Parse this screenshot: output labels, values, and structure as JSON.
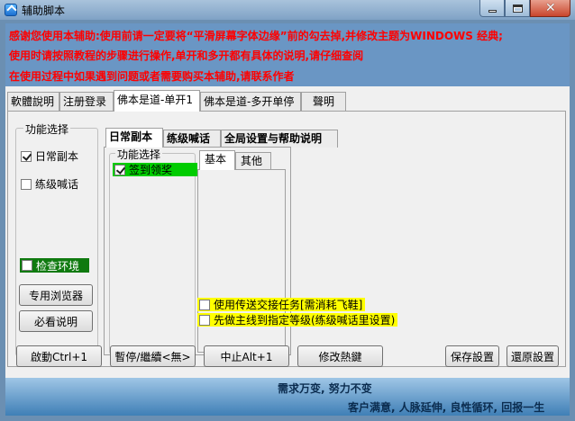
{
  "window": {
    "title": "辅助脚本"
  },
  "notice": {
    "line1": "感谢您使用本辅助:使用前请一定要将“平滑屏幕字体边缘”前的勾去掉,并修改主题为WINDOWS 经典;",
    "line2": "使用时请按照教程的步骤进行操作,单开和多开都有具体的说明,请仔细查阅",
    "line3": "在使用过程中如果遇到问题或者需要购买本辅助,请联系作者"
  },
  "top_tabs": [
    {
      "label": "軟體說明"
    },
    {
      "label": "注册登录"
    },
    {
      "label": "佛本是道-单开1"
    },
    {
      "label": "佛本是道-多开单停"
    },
    {
      "label": "聲明"
    }
  ],
  "left_group": {
    "caption": "功能选择",
    "daily_label": "日常副本",
    "daily_checked": true,
    "level_label": "练级喊话",
    "level_checked": false,
    "env_label": "检查环境",
    "env_checked": false,
    "browser_button": "专用浏览器",
    "guide_button": "必看说明"
  },
  "sub_tabs": [
    {
      "label": "日常副本"
    },
    {
      "label": "练级喊话"
    },
    {
      "label": "全局设置与帮助说明"
    }
  ],
  "function_group": {
    "caption": "功能选择",
    "signin_label": "签到领奖",
    "signin_checked": true
  },
  "inner_tabs": [
    {
      "label": "基本"
    },
    {
      "label": "其他"
    }
  ],
  "options": {
    "teleport_label": "使用传送交接任务[需消耗飞鞋]",
    "teleport_checked": false,
    "mainline_label": "先做主线到指定等级(练级喊话里设置)",
    "mainline_checked": false
  },
  "bottom_buttons": {
    "start": "啟動Ctrl+1",
    "pause": "暫停/繼續<無>",
    "stop": "中止Alt+1",
    "hotkey": "修改熱鍵",
    "save": "保存設置",
    "restore": "還原設置"
  },
  "footer": {
    "slogan": "需求万变, 努力不变",
    "motto": "客户满意, 人脉延伸, 良性循环, 回报一生"
  },
  "colors": {
    "notice_text": "#ff0000",
    "notice_bg": "#6a96c4",
    "green_highlight": "#00cc00",
    "yellow_highlight": "#ffff00",
    "dark_green": "#0f7a0f"
  }
}
